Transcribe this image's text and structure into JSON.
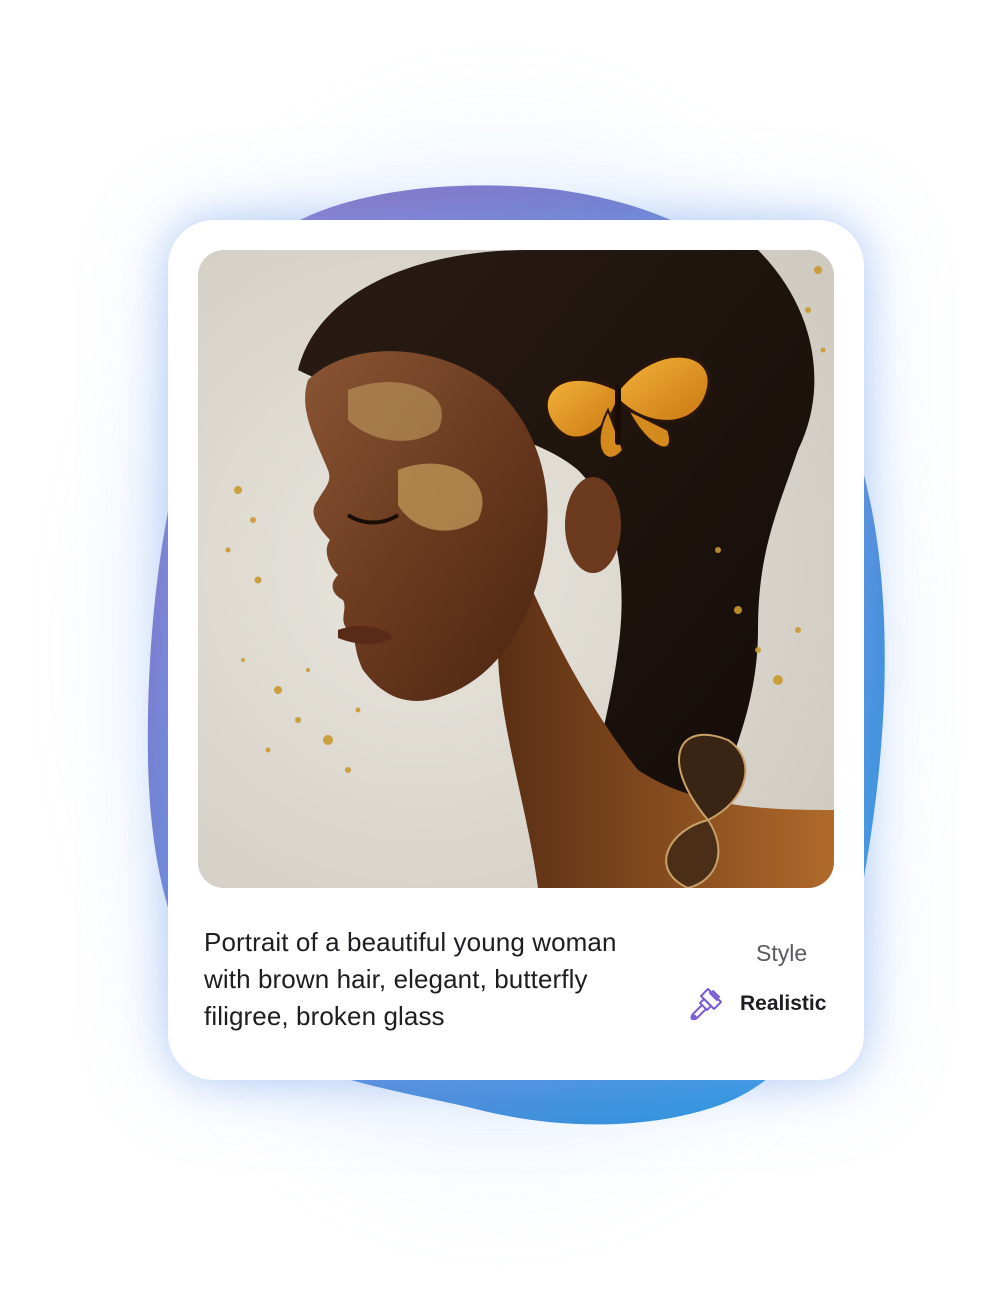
{
  "card": {
    "image_alt": "Portrait of a beautiful young woman with brown hair, elegant, butterfly filigree, broken glass",
    "prompt": "Portrait of a beautiful young woman with brown hair, elegant, butterfly filigree, broken glass",
    "style_label": "Style",
    "style_value": "Realistic",
    "style_icon": "paint-brush-icon"
  },
  "colors": {
    "blob_start": "#9a6fc2",
    "blob_end": "#2a9ae0",
    "accent_icon": "#7a5cd6",
    "text": "#1d1d22",
    "muted_text": "#5a5a60"
  }
}
